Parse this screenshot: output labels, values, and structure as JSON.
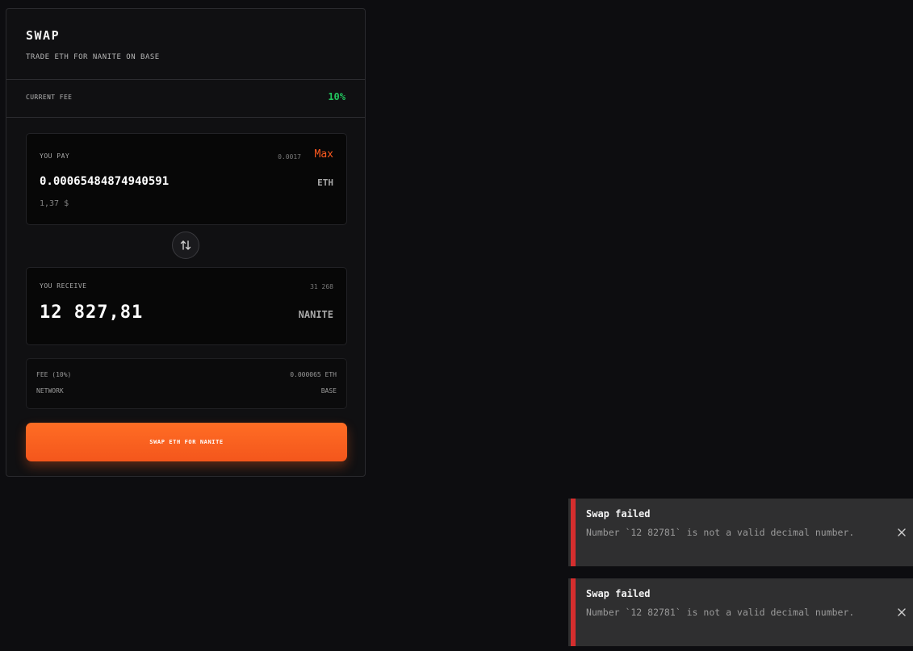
{
  "swap": {
    "title": "SWAP",
    "subtitle": "TRADE ETH FOR NANITE ON BASE",
    "fee_label": "CURRENT FEE",
    "fee_value": "10%"
  },
  "pay": {
    "label": "YOU PAY",
    "balance": "0.0017",
    "max_label": "Max",
    "amount": "0.00065484874940591",
    "token": "ETH",
    "usd": "1,37 $"
  },
  "receive": {
    "label": "YOU RECEIVE",
    "balance": "31 268",
    "amount": "12 827,81",
    "token": "NANITE"
  },
  "details": {
    "fee_label": "FEE (10%)",
    "fee_value": "0.000065 ETH",
    "network_label": "NETWORK",
    "network_value": "BASE"
  },
  "cta_label": "SWAP ETH FOR NANITE",
  "toasts": [
    {
      "title": "Swap failed",
      "message": "Number `12 82781` is not a valid decimal number."
    },
    {
      "title": "Swap failed",
      "message": "Number `12 82781` is not a valid decimal number."
    }
  ],
  "icons": {
    "swap_direction": "swap-arrows-icon",
    "toast_close": "close-icon"
  },
  "colors": {
    "accent": "#ff5a1f",
    "fee_green": "#22c55e",
    "error_red": "#d42e2e"
  }
}
